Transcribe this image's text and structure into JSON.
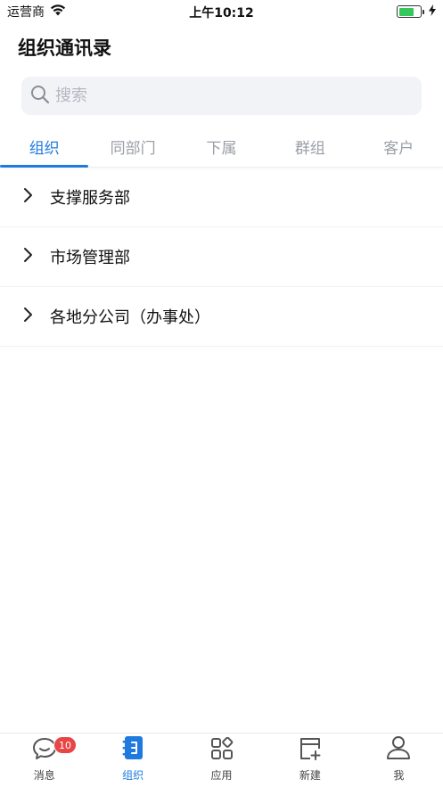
{
  "status_bar": {
    "carrier": "运营商",
    "time": "上午10:12",
    "battery_level": 0.7
  },
  "header": {
    "title": "组织通讯录"
  },
  "search": {
    "placeholder": "搜索"
  },
  "tabs": [
    {
      "label": "组织",
      "active": true
    },
    {
      "label": "同部门",
      "active": false
    },
    {
      "label": "下属",
      "active": false
    },
    {
      "label": "群组",
      "active": false
    },
    {
      "label": "客户",
      "active": false
    }
  ],
  "departments": [
    {
      "label": "支撑服务部"
    },
    {
      "label": "市场管理部"
    },
    {
      "label": "各地分公司（办事处）"
    }
  ],
  "bottom_nav": {
    "items": [
      {
        "label": "消息",
        "icon": "chat-bubble-icon",
        "badge": "10"
      },
      {
        "label": "组织",
        "icon": "address-book-icon",
        "active": true
      },
      {
        "label": "应用",
        "icon": "apps-grid-icon"
      },
      {
        "label": "新建",
        "icon": "new-document-icon"
      },
      {
        "label": "我",
        "icon": "person-icon"
      }
    ]
  },
  "colors": {
    "accent": "#1f7ae0",
    "badge": "#e84545",
    "battery": "#34c759"
  }
}
